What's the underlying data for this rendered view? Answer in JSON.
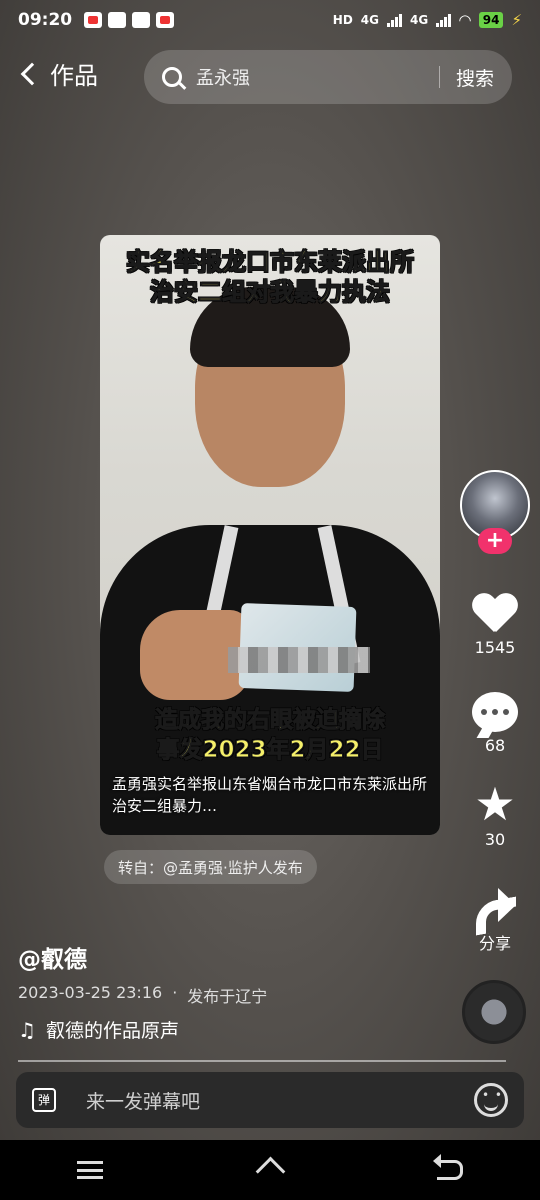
{
  "status_bar": {
    "time": "09:20",
    "network_hd": "HD",
    "network_1": "4G",
    "network_2": "4G",
    "battery": "94"
  },
  "header": {
    "back_label": "作品",
    "search_query": "孟永强",
    "search_button": "搜索"
  },
  "video": {
    "caption_top_1": "实名举报龙口市东莱派出所",
    "caption_top_2": "治安二组对我暴力执法",
    "caption_bottom_1": "造成我的右眼被迫摘除",
    "caption_bottom_2": "事发2023年2月22日",
    "overlay_description": "孟勇强实名举报山东省烟台市龙口市东莱派出所治安二组暴力…"
  },
  "repost": {
    "label": "转自：@孟勇强·监护人发布"
  },
  "right_rail": {
    "follow_symbol": "+",
    "likes": "1545",
    "comments": "68",
    "favorites": "30",
    "share_label": "分享"
  },
  "post": {
    "author": "@叡德",
    "date": "2023-03-25 23:16",
    "location": "发布于辽宁",
    "music": "叡德的作品原声"
  },
  "comment_bar": {
    "danmaku_icon_text": "弹",
    "placeholder": "来一发弹幕吧"
  },
  "colors": {
    "follow_pink": "#f1326c",
    "caption_yellow": "#f5f06a",
    "battery_green": "#6ad146"
  }
}
